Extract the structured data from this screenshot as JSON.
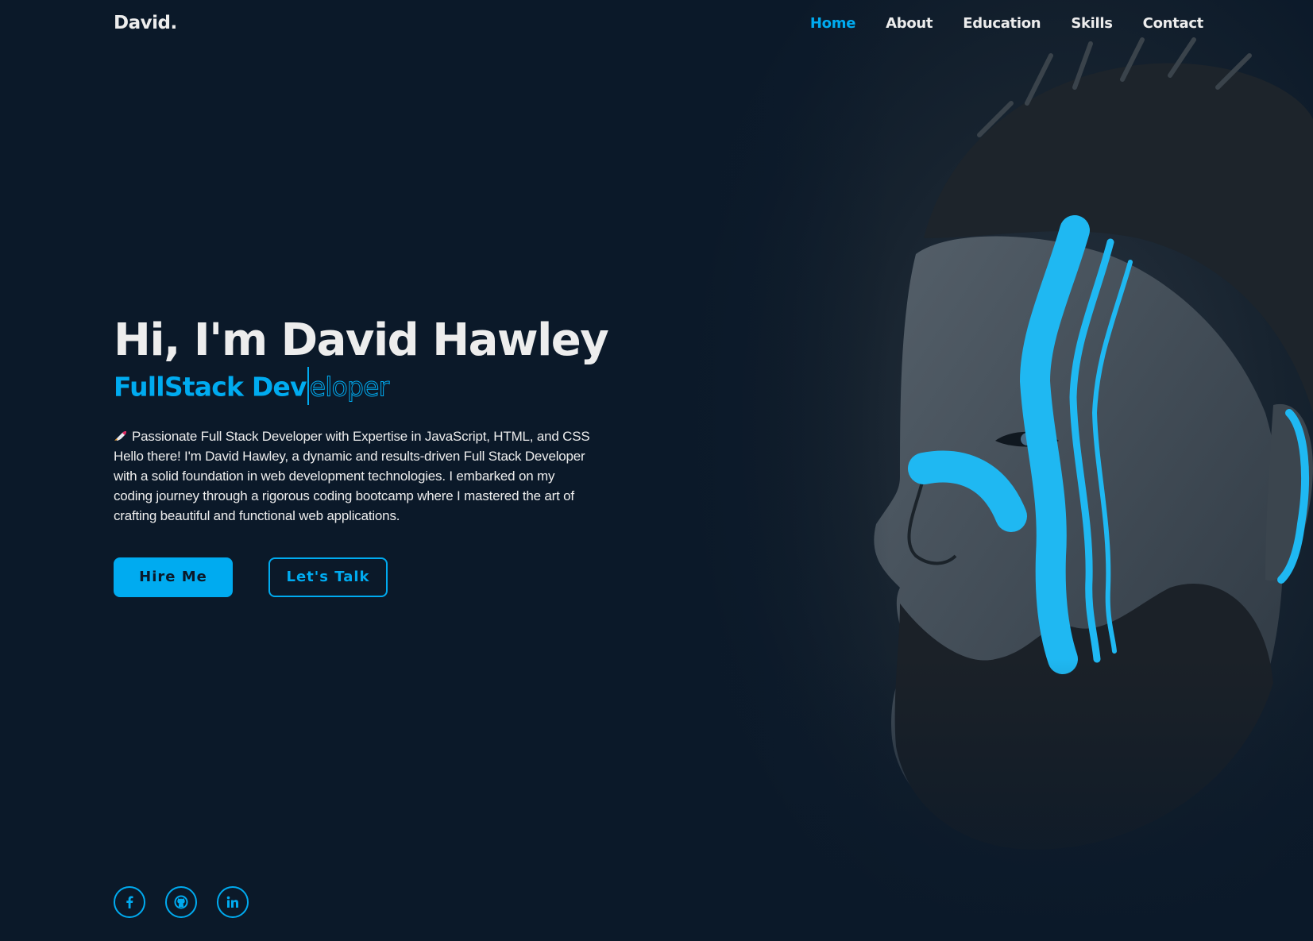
{
  "header": {
    "logo": "David.",
    "nav": [
      {
        "label": "Home",
        "active": true
      },
      {
        "label": "About",
        "active": false
      },
      {
        "label": "Education",
        "active": false
      },
      {
        "label": "Skills",
        "active": false
      },
      {
        "label": "Contact",
        "active": false
      }
    ]
  },
  "hero": {
    "heading": "Hi, I'm David Hawley",
    "role_typed": "FullStack Dev",
    "role_remaining": "eloper",
    "description": "Passionate Full Stack Developer with Expertise in JavaScript, HTML, and CSS Hello there! I'm David Hawley, a dynamic and results-driven Full Stack Developer with a solid foundation in web development technologies. I embarked on my coding journey through a rigorous coding bootcamp where I mastered the art of crafting beautiful and functional web applications.",
    "buttons": {
      "primary": "Hire Me",
      "secondary": "Let's Talk"
    }
  },
  "socials": [
    {
      "name": "facebook-icon",
      "glyph": "f"
    },
    {
      "name": "github-icon",
      "glyph": ""
    },
    {
      "name": "linkedin-icon",
      "glyph": "in"
    }
  ],
  "colors": {
    "background": "#0b1929",
    "accent": "#00abf0",
    "text": "#ededed"
  }
}
